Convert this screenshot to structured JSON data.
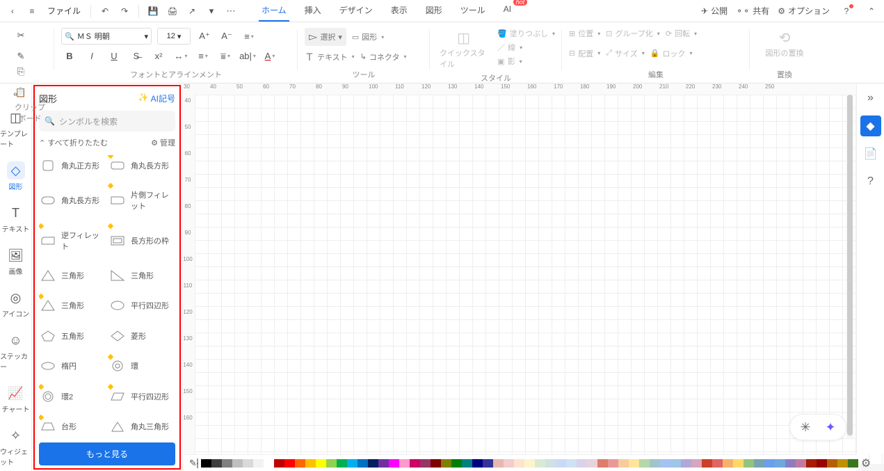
{
  "menu": {
    "file": "ファイル",
    "publish": "公開",
    "share": "共有",
    "options": "オプション"
  },
  "tabs": {
    "home": "ホーム",
    "insert": "挿入",
    "design": "デザイン",
    "view": "表示",
    "shape": "図形",
    "tool": "ツール",
    "ai": "AI",
    "hot": "hot"
  },
  "ribbon": {
    "clipboard": "クリップボード",
    "fontAlign": "フォントとアラインメント",
    "tools": "ツール",
    "style": "スタイル",
    "edit": "編集",
    "replace": "置換",
    "font": "ＭＳ 明朝",
    "size": "12",
    "select": "選択",
    "shapeBtn": "図形",
    "textBtn": "テキスト",
    "connector": "コネクタ",
    "quickStyle": "クイックスタイル",
    "fill": "塗りつぶし",
    "line": "線",
    "shadow": "影",
    "position": "位置",
    "align": "配置",
    "group": "グループ化",
    "sizeBtn": "サイズ",
    "rotate": "回転",
    "lock": "ロック",
    "shapeReplace": "図形の置換"
  },
  "leftrail": {
    "template": "テンプレート",
    "shapes": "図形",
    "text": "テキスト",
    "image": "画像",
    "icon": "アイコン",
    "sticker": "ステッカー",
    "chart": "チャート",
    "widget": "ウィジェット"
  },
  "panel": {
    "title": "図形",
    "aiSymbol": "AI記号",
    "searchPlaceholder": "シンボルを検索",
    "collapseAll": "すべて折りたたむ",
    "manage": "管理",
    "more": "もっと見る"
  },
  "shapes": [
    {
      "label": "角丸正方形",
      "diamond": false
    },
    {
      "label": "角丸長方形",
      "diamond": true
    },
    {
      "label": "角丸長方形",
      "diamond": false
    },
    {
      "label": "片側フィレット",
      "diamond": true
    },
    {
      "label": "逆フィレット",
      "diamond": true
    },
    {
      "label": "長方形の枠",
      "diamond": true
    },
    {
      "label": "三角形",
      "diamond": false
    },
    {
      "label": "三角形",
      "diamond": false
    },
    {
      "label": "三角形",
      "diamond": true
    },
    {
      "label": "平行四辺形",
      "diamond": false
    },
    {
      "label": "五角形",
      "diamond": false
    },
    {
      "label": "菱形",
      "diamond": false
    },
    {
      "label": "楕円",
      "diamond": false
    },
    {
      "label": "環",
      "diamond": true
    },
    {
      "label": "環2",
      "diamond": true
    },
    {
      "label": "平行四辺形",
      "diamond": true
    },
    {
      "label": "台形",
      "diamond": true
    },
    {
      "label": "角丸三角形",
      "diamond": false
    }
  ],
  "hruler": [
    30,
    40,
    50,
    60,
    70,
    80,
    90,
    100,
    110,
    120,
    130,
    140,
    150,
    160,
    170,
    180,
    190,
    200,
    210,
    220,
    230,
    240,
    250
  ],
  "vruler": [
    40,
    50,
    60,
    70,
    80,
    90,
    100,
    110,
    120,
    130,
    140,
    150,
    160
  ],
  "colors": [
    "#000000",
    "#3f3f3f",
    "#7f7f7f",
    "#bfbfbf",
    "#d9d9d9",
    "#f2f2f2",
    "#ffffff",
    "#c00000",
    "#ff0000",
    "#ff6600",
    "#ffc000",
    "#ffff00",
    "#92d050",
    "#00b050",
    "#00b0f0",
    "#0070c0",
    "#002060",
    "#7030a0",
    "#ff00ff",
    "#ff99cc",
    "#cc0066",
    "#993366",
    "#800000",
    "#808000",
    "#008000",
    "#008080",
    "#000080",
    "#333399",
    "#e6b8af",
    "#f4cccc",
    "#fce5cd",
    "#fff2cc",
    "#d9ead3",
    "#d0e0e3",
    "#c9daf8",
    "#cfe2f3",
    "#d9d2e9",
    "#ead1dc",
    "#dd7e6b",
    "#ea9999",
    "#f9cb9c",
    "#ffe599",
    "#b6d7a8",
    "#a2c4c9",
    "#a4c2f4",
    "#9fc5e8",
    "#b4a7d6",
    "#d5a6bd",
    "#cc4125",
    "#e06666",
    "#f6b26b",
    "#ffd966",
    "#93c47d",
    "#76a5af",
    "#6d9eeb",
    "#6fa8dc",
    "#8e7cc3",
    "#c27ba0",
    "#a61c00",
    "#990000",
    "#b45f06",
    "#bf9000",
    "#38761d"
  ]
}
